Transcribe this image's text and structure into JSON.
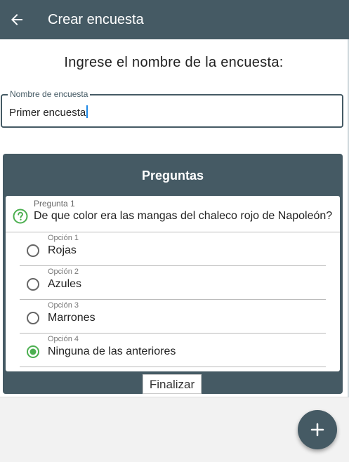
{
  "appbar": {
    "title": "Crear encuesta",
    "back_icon": "arrow-back-icon"
  },
  "form": {
    "prompt": "Ingrese el nombre de la encuesta:",
    "name_field": {
      "label": "Nombre de encuesta",
      "value": "Primer encuesta"
    }
  },
  "questions": {
    "title": "Preguntas",
    "items": [
      {
        "label": "Pregunta 1",
        "text": "De que color era las mangas del chaleco rojo de Napoleón?",
        "icon": "question-circle-icon",
        "options": [
          {
            "label": "Opción 1",
            "text": "Rojas",
            "selected": false
          },
          {
            "label": "Opción 2",
            "text": "Azules",
            "selected": false
          },
          {
            "label": "Opción 3",
            "text": "Marrones",
            "selected": false
          },
          {
            "label": "Opción 4",
            "text": "Ninguna de las anteriores",
            "selected": true
          }
        ]
      }
    ]
  },
  "actions": {
    "finish_label": "Finalizar",
    "fab_icon": "plus-icon"
  },
  "colors": {
    "primary": "#455a64",
    "accent_green": "#4caf50",
    "caret": "#1e88e5"
  }
}
